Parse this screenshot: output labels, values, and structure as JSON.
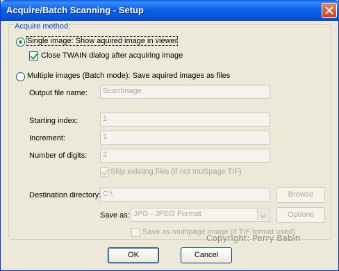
{
  "window": {
    "title": "Acquire/Batch Scanning - Setup"
  },
  "acquire_method": {
    "legend": "Acquire method:",
    "single_label": "Single image: Show aquired image in viewer",
    "close_twain_label": "Close TWAIN dialog after acquiring image",
    "multiple_label": "Multiple images (Batch mode): Save aquired images as files"
  },
  "batch": {
    "output_file_name_label": "Output file name:",
    "output_file_name_value": "ScanImage",
    "starting_index_label": "Starting index:",
    "starting_index_value": "1",
    "increment_label": "Increment:",
    "increment_value": "1",
    "digits_label": "Number of digits:",
    "digits_value": "2",
    "skip_existing_label": "Skip existing files (if not multipage TIF)",
    "destination_label": "Destination directory:",
    "destination_value": "C:\\",
    "browse_label": "Browse",
    "save_as_label": "Save as:",
    "save_as_value": "JPG - JPEG Format",
    "options_label": "Options",
    "multipage_label": "Save as multipage image (if TIF format used)"
  },
  "watermark": "Copyright: Perry Babin",
  "buttons": {
    "ok": "OK",
    "cancel": "Cancel"
  }
}
